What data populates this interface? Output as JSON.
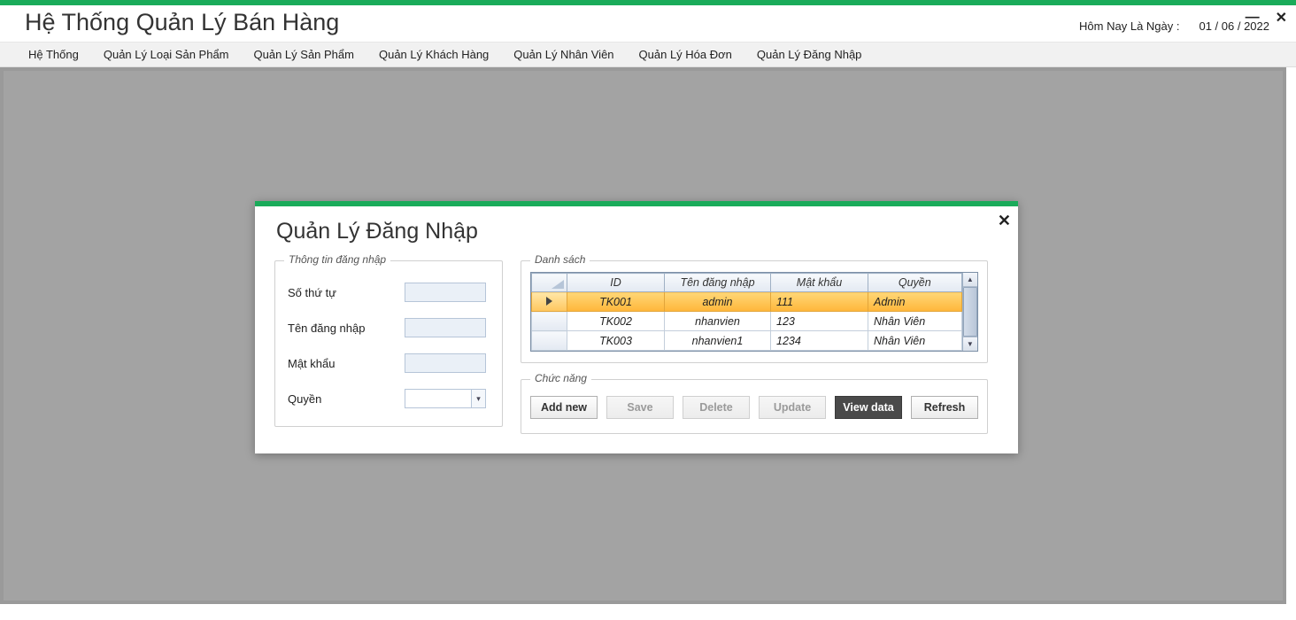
{
  "window": {
    "minimize_glyph": "—",
    "close_glyph": "✕"
  },
  "header": {
    "title": "Hệ Thống Quản Lý Bán Hàng",
    "date_label": "Hôm Nay Là Ngày :",
    "date_value": "01 / 06 / 2022"
  },
  "menu": {
    "items": [
      "Hệ Thống",
      "Quản Lý Loại Sản Phẩm",
      "Quản Lý Sản Phẩm",
      "Quản Lý Khách Hàng",
      "Quản Lý Nhân Viên",
      "Quản Lý Hóa Đơn",
      "Quản Lý Đăng Nhập"
    ]
  },
  "dialog": {
    "title": "Quản Lý Đăng Nhập",
    "close_glyph": "✕",
    "info_group_label": "Thông tin đăng nhập",
    "fields": {
      "so_thu_tu_label": "Số thứ tự",
      "ten_dang_nhap_label": "Tên đăng nhập",
      "mat_khau_label": "Mật khẩu",
      "quyen_label": "Quyền",
      "combo_glyph": "▾"
    },
    "list_group_label": "Danh sách",
    "func_group_label": "Chức năng",
    "columns": {
      "id": "ID",
      "ten": "Tên đăng nhập",
      "mk": "Mật khẩu",
      "quyen": "Quyền"
    },
    "rows": [
      {
        "id": "TK001",
        "ten": "admin",
        "mk": "111",
        "quyen": "Admin",
        "selected": true
      },
      {
        "id": "TK002",
        "ten": "nhanvien",
        "mk": "123",
        "quyen": "Nhân Viên",
        "selected": false
      },
      {
        "id": "TK003",
        "ten": "nhanvien1",
        "mk": "1234",
        "quyen": "Nhân Viên",
        "selected": false
      }
    ],
    "buttons": {
      "add": "Add new",
      "save": "Save",
      "delete": "Delete",
      "update": "Update",
      "view": "View data",
      "refresh": "Refresh"
    },
    "scroll": {
      "up_glyph": "▲",
      "down_glyph": "▼"
    }
  }
}
